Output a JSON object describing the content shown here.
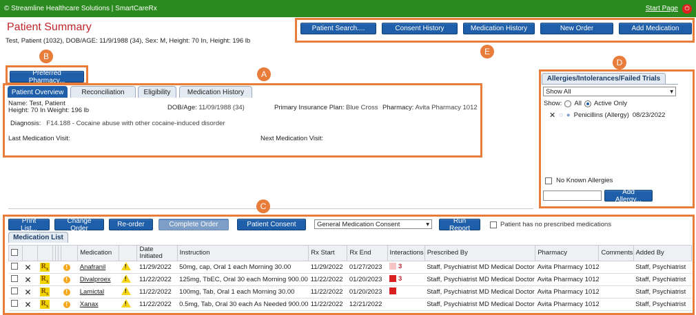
{
  "topbar": {
    "title": "© Streamline Healthcare Solutions | SmartCareRx",
    "start_page": "Start Page"
  },
  "page": {
    "title": "Patient Summary",
    "patient_line": "Test, Patient (1032), DOB/AGE: 11/9/1988 (34), Sex: M, Height: 70 In, Height: 196 lb"
  },
  "toolbar": {
    "patient_search": "Patient Search....",
    "consent_history": "Consent History",
    "medication_history": "Medication History",
    "new_order": "New Order",
    "add_medication": "Add Medication"
  },
  "callouts": {
    "a": "A",
    "b": "B",
    "c": "C",
    "d": "D",
    "e": "E"
  },
  "preferred_pharmacy": "Preferred Pharmacy...",
  "tabs": [
    "Patient Overview",
    "Reconciliation",
    "Eligibility",
    "Medication History"
  ],
  "overview": {
    "name": "Name: Test, Patient",
    "height_weight": "Height: 70 In Weight: 196 lb",
    "dob_label": "DOB/Age:",
    "dob_value": "11/09/1988 (34)",
    "insurance_label": "Primary Insurance Plan:",
    "insurance_value": "Blue Cross",
    "pharmacy_label": "Pharmacy:",
    "pharmacy_value": "Avita Pharmacy 1012",
    "diagnosis_label": "Diagnosis:",
    "diagnosis_value": "F14.188 - Cocaine abuse with other cocaine-induced disorder",
    "last_visit": "Last Medication Visit:",
    "next_visit": "Next Medication Visit:"
  },
  "allergies": {
    "tab": "Allergies/Intolerances/Failed Trials",
    "filter": "Show All",
    "show_label": "Show:",
    "all": "All",
    "active_only": "Active Only",
    "item": "Penicillins (Allergy)",
    "item_date": "08/23/2022",
    "no_known": "No Known Allergies",
    "add_button": "Add Allergy..."
  },
  "medlist_toolbar": {
    "print_list": "Print List...",
    "change_order": "Change Order",
    "reorder": "Re-order",
    "complete_order": "Complete Order",
    "patient_consent": "Patient Consent",
    "consent_select": "General Medication Consent",
    "run_report": "Run Report",
    "no_meds": "Patient has no prescribed medications"
  },
  "medlist_tab": "Medication List",
  "columns": [
    "Medication",
    "Date Initiated",
    "Instruction",
    "Rx Start",
    "Rx End",
    "Interactions",
    "Prescribed By",
    "Pharmacy",
    "Comments",
    "Added By"
  ],
  "medications": [
    {
      "name": "Anafranil",
      "date": "11/29/2022",
      "instruction": "50mg, cap, Oral 1 each Morning 30.00",
      "rx_start": "11/29/2022",
      "rx_end": "01/27/2023",
      "interaction": "3",
      "prescribed_by": "Staff, Psychiatrist MD Medical Doctor",
      "pharmacy": "Avita Pharmacy 1012",
      "comments": "",
      "added_by": "Staff, Psychiatrist"
    },
    {
      "name": "Divalproex",
      "date": "11/22/2022",
      "instruction": "125mg, TbEC, Oral 30 each Morning 900.00",
      "rx_start": "11/22/2022",
      "rx_end": "01/20/2023",
      "interaction": "3",
      "prescribed_by": "Staff, Psychiatrist MD Medical Doctor",
      "pharmacy": "Avita Pharmacy 1012",
      "comments": "",
      "added_by": "Staff, Psychiatrist"
    },
    {
      "name": "Lamictal",
      "date": "11/22/2022",
      "instruction": "100mg, Tab, Oral 1 each Morning 30.00",
      "rx_start": "11/22/2022",
      "rx_end": "01/20/2023",
      "interaction": "",
      "prescribed_by": "Staff, Psychiatrist MD Medical Doctor",
      "pharmacy": "Avita Pharmacy 1012",
      "comments": "",
      "added_by": "Staff, Psychiatrist"
    },
    {
      "name": "Xanax",
      "date": "11/22/2022",
      "instruction": "0.5mg, Tab, Oral 30 each As Needed 900.00",
      "rx_start": "11/22/2022",
      "rx_end": "12/21/2022",
      "interaction": "",
      "prescribed_by": "Staff, Psychiatrist MD Medical Doctor",
      "pharmacy": "Avita Pharmacy 1012",
      "comments": "",
      "added_by": "Staff, Psychiatrist"
    }
  ],
  "colors": {
    "brand_green": "#2b8a1f",
    "button_blue": "#1f5ea8",
    "callout_orange": "#e87c3a",
    "title_red": "#c0262c"
  }
}
